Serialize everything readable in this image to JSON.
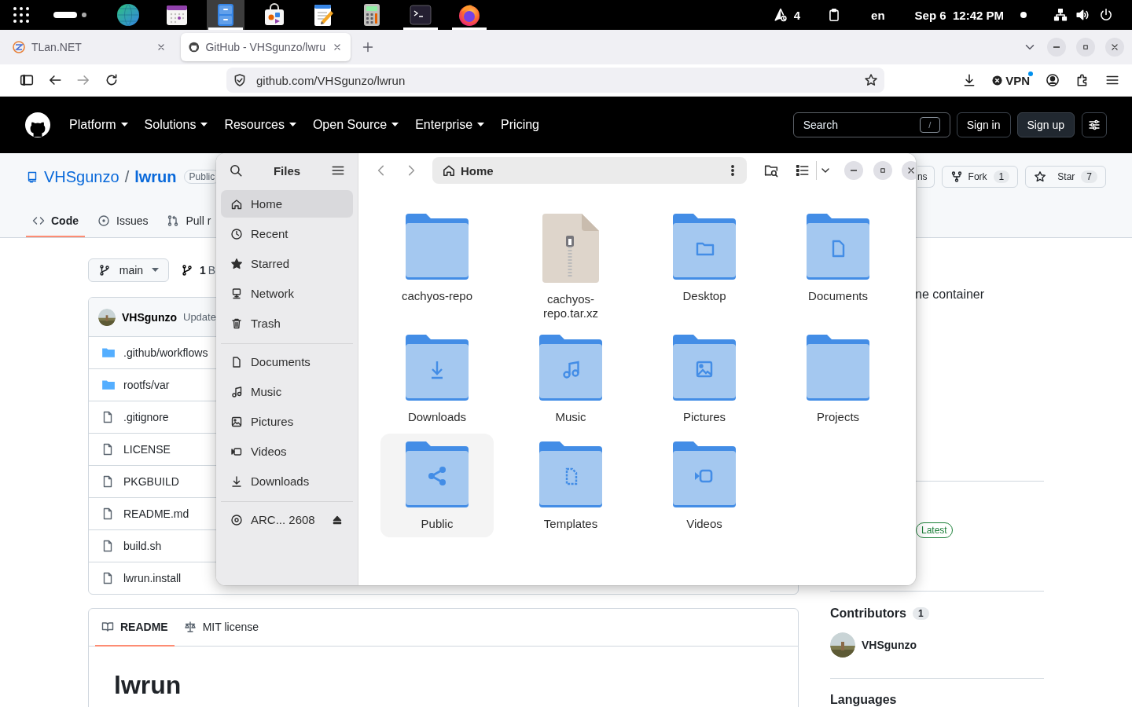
{
  "top_bar": {
    "dock": [
      {
        "kind": "globe",
        "running": false,
        "selected": false
      },
      {
        "kind": "calendar",
        "running": false,
        "selected": false
      },
      {
        "kind": "files",
        "running": true,
        "selected": true
      },
      {
        "kind": "store",
        "running": false,
        "selected": false
      },
      {
        "kind": "editor",
        "running": false,
        "selected": false
      },
      {
        "kind": "calculator",
        "running": false,
        "selected": false
      },
      {
        "kind": "terminal",
        "running": true,
        "selected": false
      },
      {
        "kind": "firefox",
        "running": true,
        "selected": false
      }
    ],
    "updates": "4",
    "keyboard": "en",
    "clock": "Sep 6  12:42 PM"
  },
  "browser": {
    "tabs": [
      {
        "title": "TLan.NET",
        "kind": "tlan",
        "selected": false
      },
      {
        "title": "GitHub - VHSgunzo/lwru",
        "kind": "github",
        "selected": true
      }
    ],
    "url": "github.com/VHSgunzo/lwrun",
    "vpn": "VPN"
  },
  "github": {
    "nav": [
      {
        "label": "Platform",
        "menu": true
      },
      {
        "label": "Solutions",
        "menu": true
      },
      {
        "label": "Resources",
        "menu": true
      },
      {
        "label": "Open Source",
        "menu": true
      },
      {
        "label": "Enterprise",
        "menu": true
      },
      {
        "label": "Pricing",
        "menu": false
      }
    ],
    "search": {
      "placeholder": "Search",
      "shortcut": "/"
    },
    "sign_in": "Sign in",
    "sign_up": "Sign up",
    "repo": {
      "owner": "VHSgunzo",
      "separator": "/",
      "name": "lwrun",
      "visibility": "Public",
      "actions": [
        {
          "kind": "watch",
          "label": "ns"
        },
        {
          "kind": "fork",
          "label": "Fork",
          "count": "1"
        },
        {
          "kind": "star",
          "label": "Star",
          "count": "7"
        }
      ],
      "tabs": [
        {
          "kind": "code",
          "label": "Code",
          "selected": true
        },
        {
          "kind": "issues",
          "label": "Issues",
          "selected": false
        },
        {
          "kind": "pulls",
          "label": "Pull r",
          "selected": false
        }
      ]
    },
    "branch": "main",
    "branches": "1 B",
    "commit": {
      "author": "VHSgunzo",
      "message": "Update"
    },
    "files": [
      {
        "name": ".github/workflows",
        "kind": "folder"
      },
      {
        "name": "rootfs/var",
        "kind": "folder"
      },
      {
        "name": ".gitignore",
        "kind": "file"
      },
      {
        "name": "LICENSE",
        "kind": "file"
      },
      {
        "name": "PKGBUILD",
        "kind": "file"
      },
      {
        "name": "README.md",
        "kind": "file"
      },
      {
        "name": "build.sh",
        "kind": "file"
      },
      {
        "name": "lwrun.install",
        "kind": "file"
      }
    ],
    "readme_tabs": [
      {
        "kind": "readme",
        "label": "README",
        "selected": true
      },
      {
        "kind": "license",
        "label": "MIT license",
        "selected": false
      }
    ],
    "readme_title": "lwrun",
    "about": "ne container",
    "release_badge": "Latest",
    "contributors": {
      "title": "Contributors",
      "count": "1",
      "people": [
        {
          "name": "VHSgunzo"
        }
      ]
    },
    "languages_title": "Languages"
  },
  "files_window": {
    "title": "Files",
    "path": "Home",
    "places": [
      {
        "label": "Home",
        "selected": true
      },
      {
        "label": "Recent",
        "selected": false
      },
      {
        "label": "Starred",
        "selected": false
      },
      {
        "label": "Network",
        "selected": false
      },
      {
        "label": "Trash",
        "selected": false
      }
    ],
    "bookmarks": [
      {
        "label": "Documents",
        "selected": false
      },
      {
        "label": "Music",
        "selected": false
      },
      {
        "label": "Pictures",
        "selected": false
      },
      {
        "label": "Videos",
        "selected": false
      },
      {
        "label": "Downloads",
        "selected": false
      }
    ],
    "devices": [
      {
        "label": "ARC... 2608",
        "ejectable": true,
        "selected": false
      }
    ],
    "items": [
      {
        "name": "cachyos-repo",
        "kind": "folder",
        "selected": false
      },
      {
        "name": "cachyos-repo.tar.xz",
        "kind": "archive",
        "selected": false
      },
      {
        "name": "Desktop",
        "kind": "desktop",
        "selected": false
      },
      {
        "name": "Documents",
        "kind": "documents",
        "selected": false
      },
      {
        "name": "Downloads",
        "kind": "downloads",
        "selected": false
      },
      {
        "name": "Music",
        "kind": "music",
        "selected": false
      },
      {
        "name": "Pictures",
        "kind": "pictures",
        "selected": false
      },
      {
        "name": "Projects",
        "kind": "folder",
        "selected": false
      },
      {
        "name": "Public",
        "kind": "public",
        "selected": true
      },
      {
        "name": "Templates",
        "kind": "templates",
        "selected": false
      },
      {
        "name": "Videos",
        "kind": "videos",
        "selected": false
      }
    ]
  }
}
